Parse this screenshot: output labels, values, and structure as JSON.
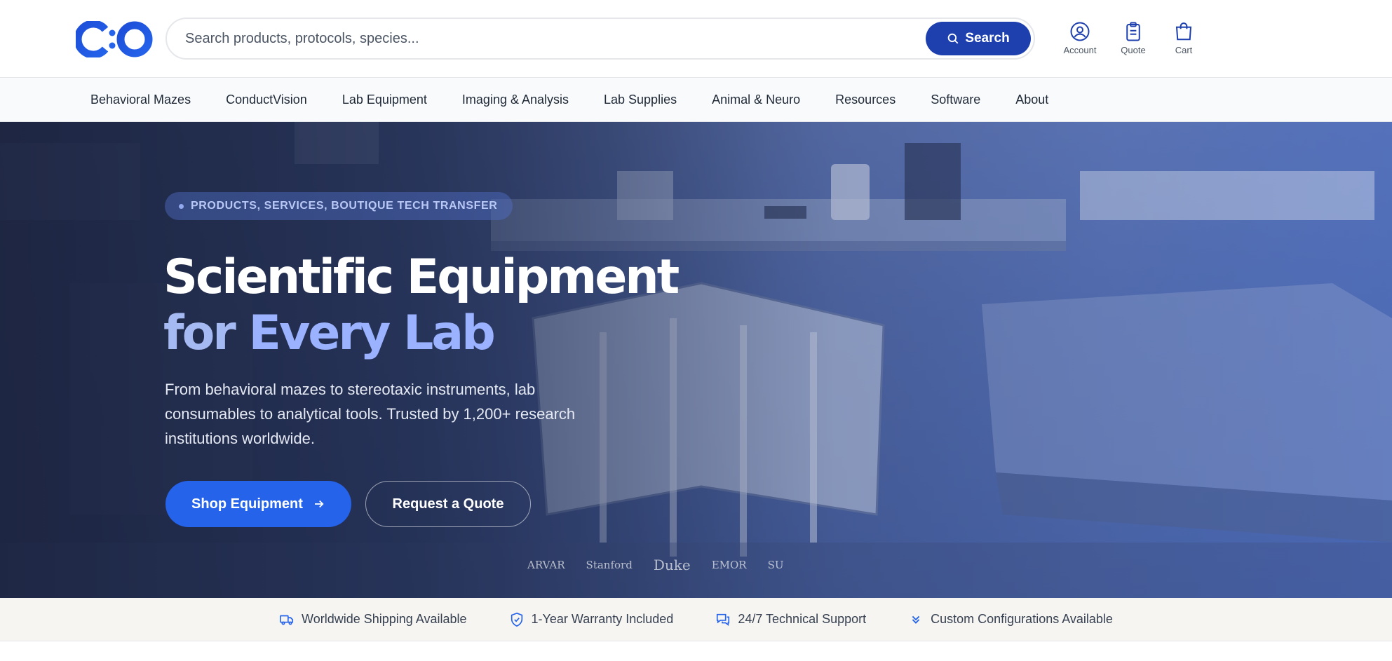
{
  "header": {
    "logo_text": "C:O",
    "search": {
      "placeholder": "Search products, protocols, species...",
      "button_label": "Search"
    },
    "actions": [
      {
        "label": "Account",
        "icon": "user-circle-icon"
      },
      {
        "label": "Quote",
        "icon": "clipboard-icon"
      },
      {
        "label": "Cart",
        "icon": "shopping-bag-icon"
      }
    ]
  },
  "nav": {
    "items": [
      "Behavioral Mazes",
      "ConductVision",
      "Lab Equipment",
      "Imaging & Analysis",
      "Lab Supplies",
      "Animal & Neuro",
      "Resources",
      "Software",
      "About"
    ]
  },
  "hero": {
    "badge": "PRODUCTS, SERVICES, BOUTIQUE TECH TRANSFER",
    "title_line1": "Scientific Equipment",
    "title_line2_prefix": "for ",
    "title_line2_highlight": "Every Lab",
    "lead": "From behavioral mazes to stereotaxic instruments, lab consumables to analytical tools. Trusted by 1,200+ research institutions worldwide.",
    "primary_cta": "Shop Equipment",
    "secondary_cta": "Request a Quote",
    "institutions": [
      "ARVAR",
      "Stanford",
      "Duke",
      "EMOR",
      "SU"
    ]
  },
  "features": [
    {
      "label": "Worldwide Shipping Available",
      "icon": "truck-icon"
    },
    {
      "label": "1-Year Warranty Included",
      "icon": "shield-check-icon"
    },
    {
      "label": "24/7 Technical Support",
      "icon": "chat-bubbles-icon"
    },
    {
      "label": "Custom Configurations Available",
      "icon": "chevron-badge-icon"
    }
  ],
  "colors": {
    "brand_primary": "#1e40af",
    "brand_accent": "#2563eb",
    "highlight": "#9ab2ff"
  }
}
